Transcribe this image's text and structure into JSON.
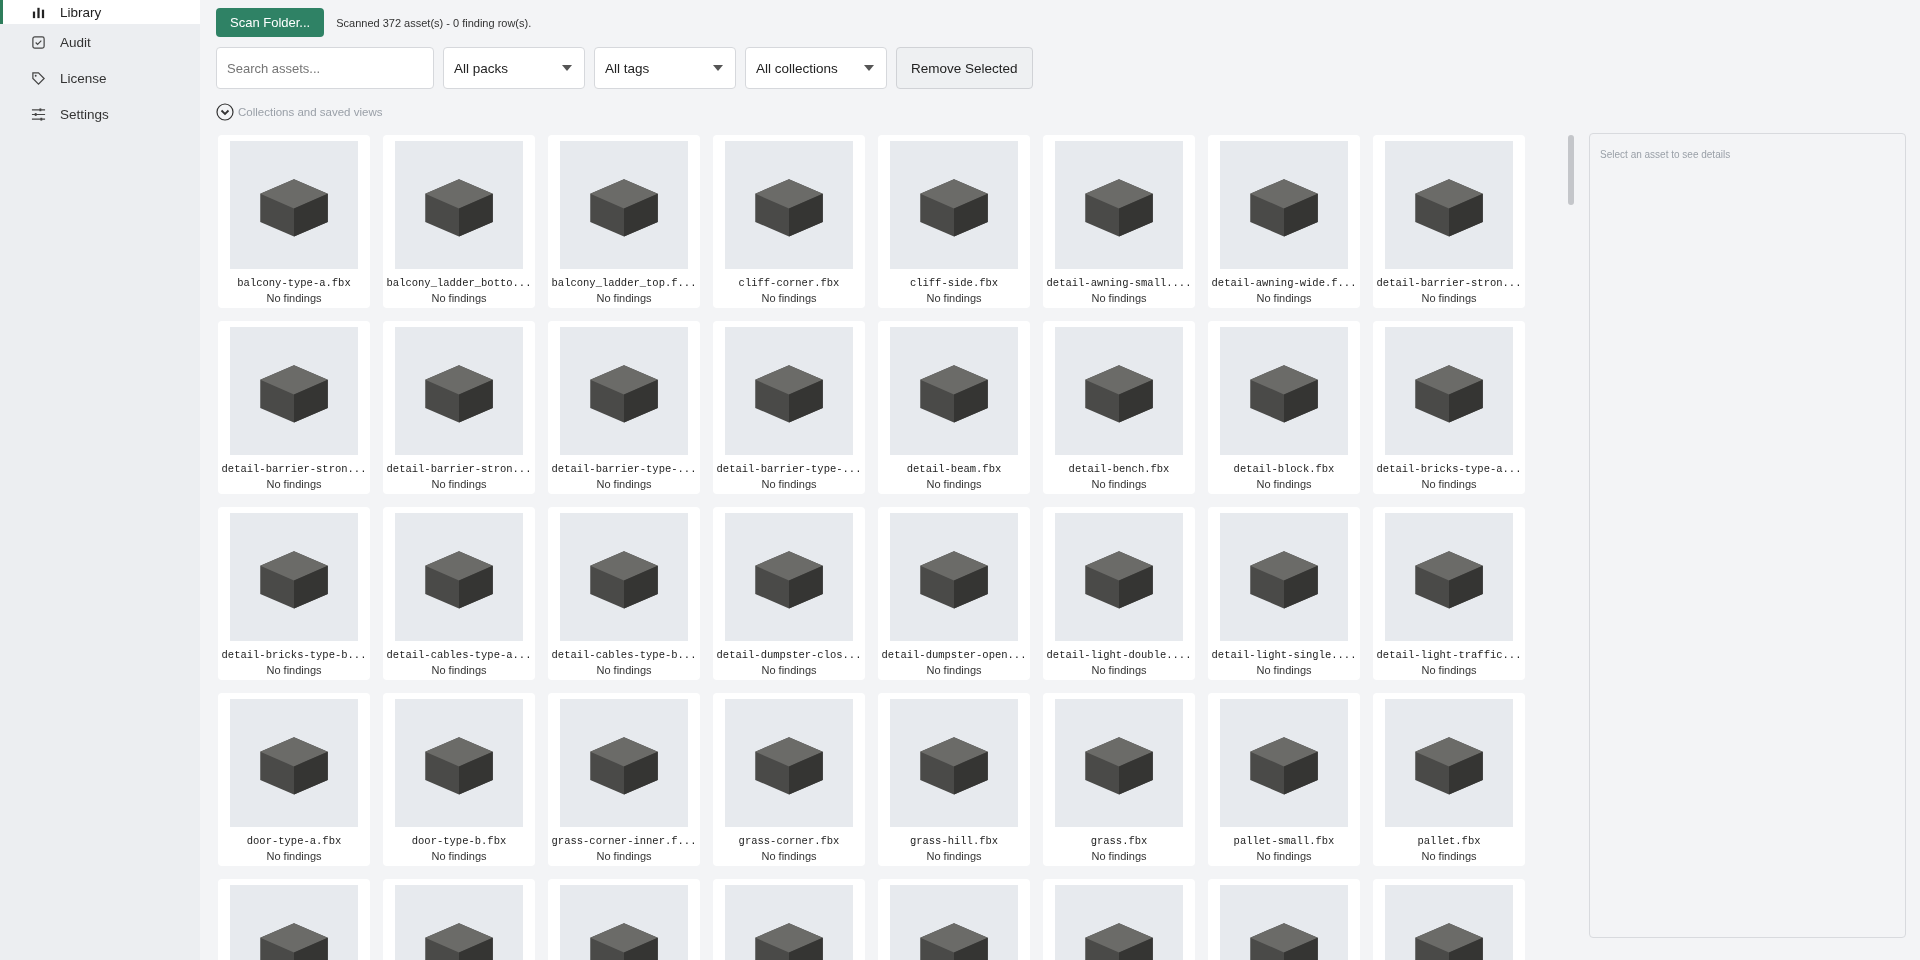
{
  "sidebar": {
    "items": [
      {
        "label": "Library",
        "selected": true
      },
      {
        "label": "Audit",
        "selected": false
      },
      {
        "label": "License",
        "selected": false
      },
      {
        "label": "Settings",
        "selected": false
      }
    ]
  },
  "toolbar": {
    "scan_button": "Scan Folder...",
    "scan_status": "Scanned 372 asset(s) - 0 finding row(s).",
    "search": {
      "placeholder": "Search assets..."
    },
    "filters": [
      "All packs",
      "All tags",
      "All collections"
    ],
    "remove_button": "Remove Selected"
  },
  "collections_toggle": {
    "label": "Collections and saved views",
    "expanded": false
  },
  "assets": [
    {
      "kind": "full",
      "name": "balcony-type-a.fbx",
      "status": "No findings"
    },
    {
      "kind": "full",
      "name": "balcony_ladder_botto...",
      "status": "No findings"
    },
    {
      "kind": "full",
      "name": "balcony_ladder_top.f...",
      "status": "No findings"
    },
    {
      "kind": "full",
      "name": "cliff-corner.fbx",
      "status": "No findings"
    },
    {
      "kind": "full",
      "name": "cliff-side.fbx",
      "status": "No findings"
    },
    {
      "kind": "full",
      "name": "detail-awning-small....",
      "status": "No findings"
    },
    {
      "kind": "full",
      "name": "detail-awning-wide.f...",
      "status": "No findings"
    },
    {
      "kind": "full",
      "name": "detail-barrier-stron...",
      "status": "No findings"
    },
    {
      "kind": "full",
      "name": "detail-barrier-stron...",
      "status": "No findings"
    },
    {
      "kind": "full",
      "name": "detail-barrier-stron...",
      "status": "No findings"
    },
    {
      "kind": "full",
      "name": "detail-barrier-type-...",
      "status": "No findings"
    },
    {
      "kind": "full",
      "name": "detail-barrier-type-...",
      "status": "No findings"
    },
    {
      "kind": "full",
      "name": "detail-beam.fbx",
      "status": "No findings"
    },
    {
      "kind": "full",
      "name": "detail-bench.fbx",
      "status": "No findings"
    },
    {
      "kind": "full",
      "name": "detail-block.fbx",
      "status": "No findings"
    },
    {
      "kind": "full",
      "name": "detail-bricks-type-a...",
      "status": "No findings"
    },
    {
      "kind": "full",
      "name": "detail-bricks-type-b...",
      "status": "No findings"
    },
    {
      "kind": "full",
      "name": "detail-cables-type-a...",
      "status": "No findings"
    },
    {
      "kind": "full",
      "name": "detail-cables-type-b...",
      "status": "No findings"
    },
    {
      "kind": "full",
      "name": "detail-dumpster-clos...",
      "status": "No findings"
    },
    {
      "kind": "full",
      "name": "detail-dumpster-open...",
      "status": "No findings"
    },
    {
      "kind": "full",
      "name": "detail-light-double....",
      "status": "No findings"
    },
    {
      "kind": "full",
      "name": "detail-light-single....",
      "status": "No findings"
    },
    {
      "kind": "full",
      "name": "detail-light-traffic...",
      "status": "No findings"
    },
    {
      "kind": "full",
      "name": "door-type-a.fbx",
      "status": "No findings"
    },
    {
      "kind": "full",
      "name": "door-type-b.fbx",
      "status": "No findings"
    },
    {
      "kind": "full",
      "name": "grass-corner-inner.f...",
      "status": "No findings"
    },
    {
      "kind": "full",
      "name": "grass-corner.fbx",
      "status": "No findings"
    },
    {
      "kind": "full",
      "name": "grass-hill.fbx",
      "status": "No findings"
    },
    {
      "kind": "full",
      "name": "grass.fbx",
      "status": "No findings"
    },
    {
      "kind": "full",
      "name": "pallet-small.fbx",
      "status": "No findings"
    },
    {
      "kind": "full",
      "name": "pallet.fbx",
      "status": "No findings"
    },
    {
      "kind": "cut"
    },
    {
      "kind": "cut"
    },
    {
      "kind": "cut"
    },
    {
      "kind": "cut"
    },
    {
      "kind": "cut"
    },
    {
      "kind": "cut"
    },
    {
      "kind": "cut"
    },
    {
      "kind": "cut"
    }
  ],
  "details": {
    "placeholder_text": "Select an asset to see details"
  }
}
